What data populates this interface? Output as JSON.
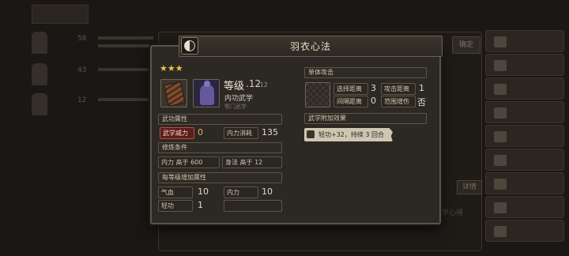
{
  "background": {
    "tab_label": "",
    "rows": [
      {
        "num": "58"
      },
      {
        "num": "43"
      },
      {
        "num": "12"
      }
    ],
    "side_buttons": [
      "",
      "",
      "",
      "",
      "",
      "",
      "",
      "",
      ""
    ],
    "top_button": "确定",
    "detail_button": "详情",
    "faint_text": "武学心得"
  },
  "popup": {
    "title": "羽衣心法",
    "stars": "★★★",
    "level_label": "等级",
    "level_current": ".12",
    "level_max": "/12",
    "skill_type": "内功武学",
    "skill_sect": "鄂门武学",
    "attr_header": "武功属性",
    "attr_power_label": "武学威力",
    "attr_power_value": "0",
    "attr_mp_label": "内力消耗",
    "attr_mp_value": "135",
    "req_header": "修炼条件",
    "req_1": "内力 高于 600",
    "req_2": "身法 高于 12",
    "bonus_header": "每等级增加属性",
    "bonus_1_label": "气血",
    "bonus_1_value": "10",
    "bonus_2_label": "内力",
    "bonus_2_value": "10",
    "bonus_3_label": "轻功",
    "bonus_3_value": "1",
    "attack_header": "单体攻击",
    "select_range_label": "选择距离",
    "select_range_value": "3",
    "attack_range_label": "攻击距离",
    "attack_range_value": "1",
    "interval_label": "间隔距离",
    "interval_value": "0",
    "spread_label": "范围增伤",
    "spread_value": "否",
    "extra_header": "武学附加效果",
    "effect_text": "轻功+32，持续 3 回合"
  },
  "colors": {
    "accent_star": "#e7c548",
    "highlight_red": "#c24a3f"
  }
}
